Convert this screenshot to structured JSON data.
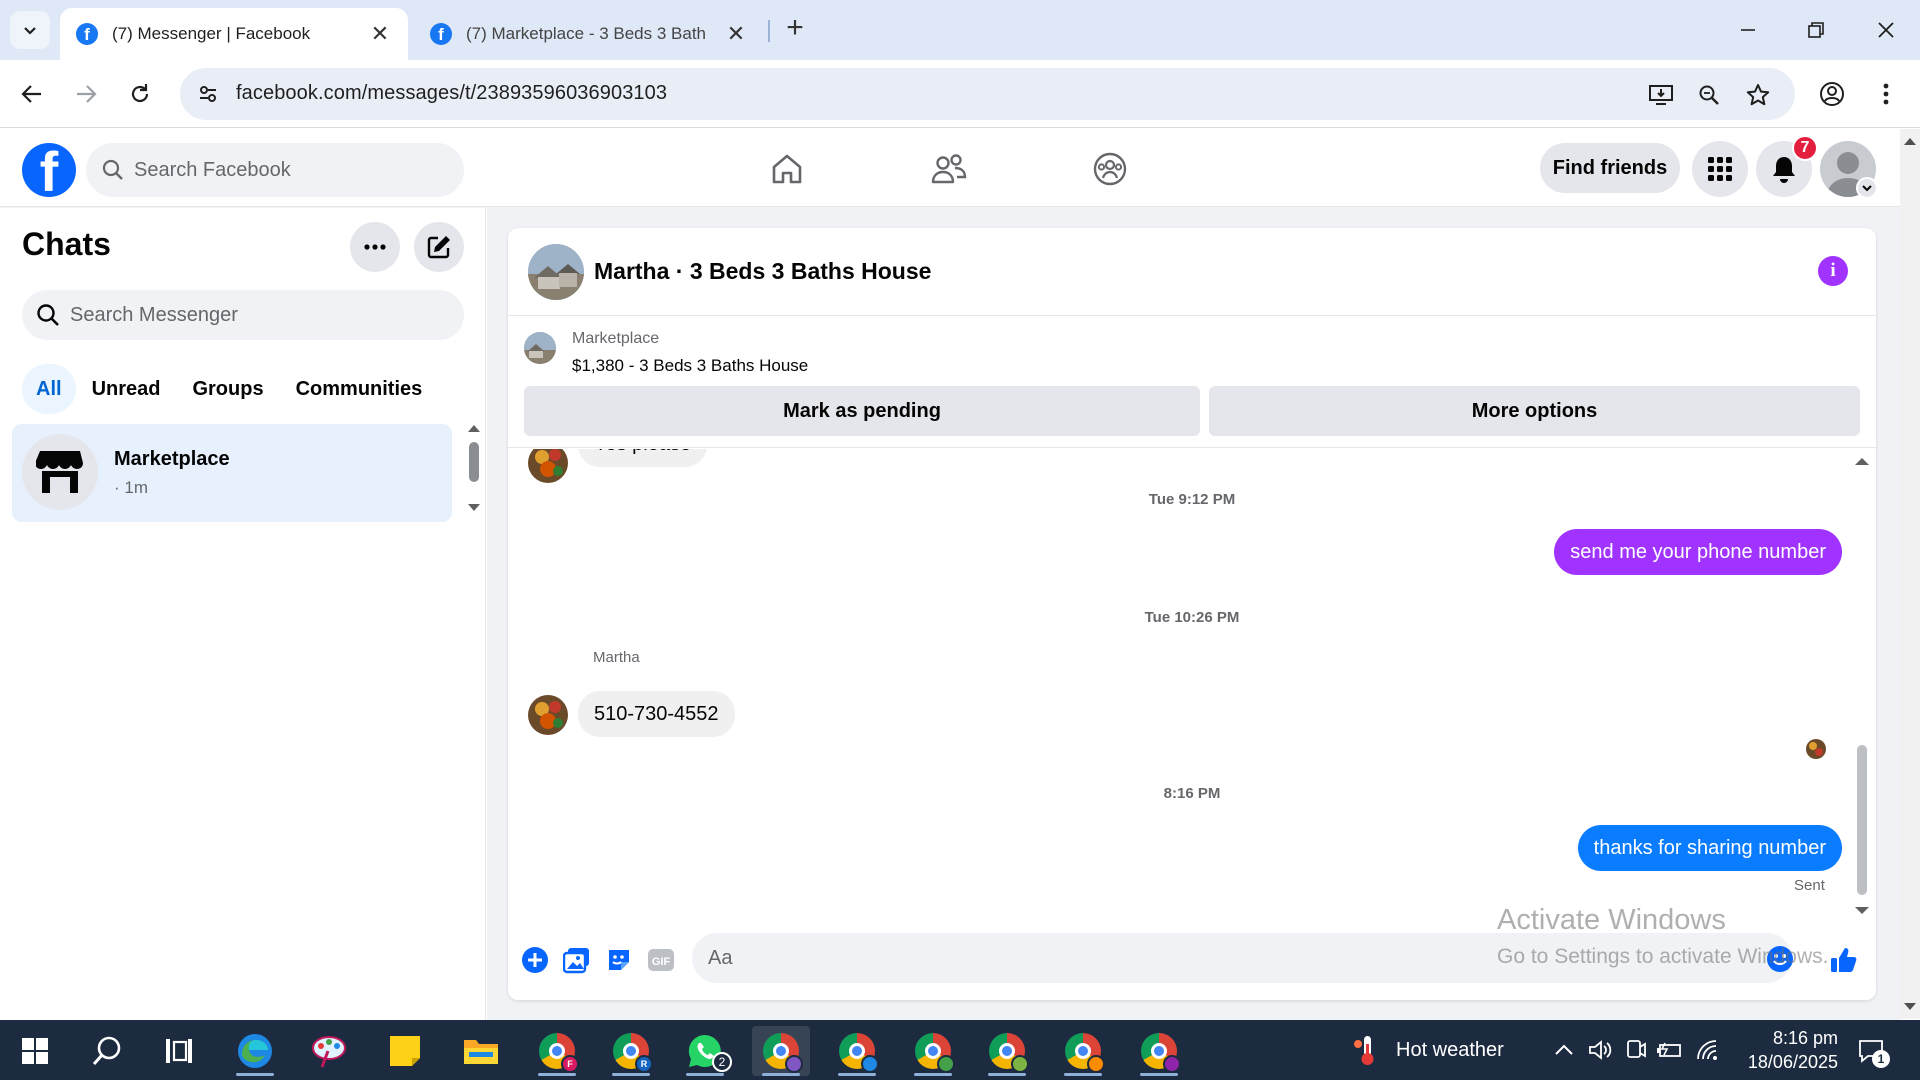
{
  "browser": {
    "tabs": [
      {
        "title": "(7) Messenger | Facebook",
        "active": true
      },
      {
        "title": "(7) Marketplace - 3 Beds 3 Bath",
        "active": false
      }
    ],
    "url": "facebook.com/messages/t/23893596036903103"
  },
  "fb": {
    "search_placeholder": "Search Facebook",
    "find_friends": "Find friends",
    "notif_count": "7"
  },
  "sidebar": {
    "title": "Chats",
    "search_placeholder": "Search Messenger",
    "filters": [
      "All",
      "Unread",
      "Groups",
      "Communities"
    ],
    "chats": [
      {
        "name": "Marketplace",
        "meta": "· 1m"
      }
    ]
  },
  "conversation": {
    "title": "Martha · 3 Beds 3 Baths House",
    "marketplace_label": "Marketplace",
    "product": "$1,380 - 3 Beds 3 Baths House",
    "mark_pending": "Mark as pending",
    "more_options": "More options",
    "messages": {
      "partial_in": "Yes please",
      "stamp1": "Tue 9:12 PM",
      "out1": "send me your phone number",
      "stamp2": "Tue 10:26 PM",
      "sender": "Martha",
      "in1": "510-730-4552",
      "stamp3": "8:16 PM",
      "out2": "thanks for sharing number",
      "sent": "Sent"
    },
    "composer_placeholder": "Aa",
    "gif_label": "GIF"
  },
  "watermark": {
    "line1": "Activate Windows",
    "line2": "Go to Settings to activate Windows."
  },
  "taskbar": {
    "weather": "Hot weather",
    "time": "8:16 pm",
    "date": "18/06/2025",
    "whatsapp_badge": "2",
    "notif_badge": "1",
    "profile_badges": [
      "F",
      "R"
    ]
  },
  "colors": {
    "fb_blue": "#0866ff",
    "bubble_purple": "#a033ff",
    "bubble_blue": "#0a7cff",
    "active_filter": "#0064d1"
  }
}
